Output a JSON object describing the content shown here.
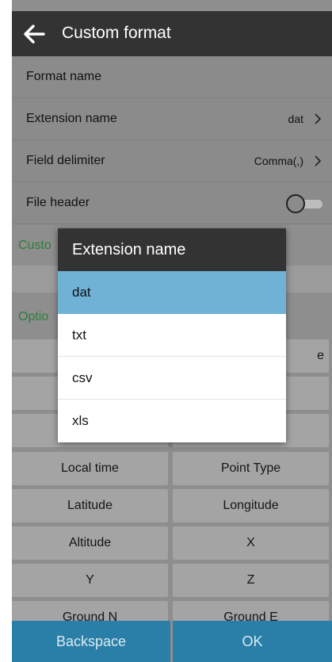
{
  "header": {
    "title": "Custom format"
  },
  "settings": {
    "format_name": {
      "label": "Format name"
    },
    "extension_name": {
      "label": "Extension name",
      "value": "dat"
    },
    "field_delimiter": {
      "label": "Field delimiter",
      "value": "Comma(,)"
    },
    "file_header": {
      "label": "File header",
      "enabled": false
    }
  },
  "sections": {
    "custom_partial": "Custo",
    "optional_partial": "Optio"
  },
  "fields": {
    "partial_right_label": "e",
    "items": [
      "Local time",
      "Point Type",
      "Latitude",
      "Longitude",
      "Altitude",
      "X",
      "Y",
      "Z",
      "Ground N",
      "Ground E"
    ]
  },
  "buttons": {
    "backspace": "Backspace",
    "ok": "OK"
  },
  "dialog": {
    "title": "Extension name",
    "options": [
      "dat",
      "txt",
      "csv",
      "xls"
    ],
    "selected": "dat"
  },
  "colors": {
    "topbar": "#333333",
    "dialog_selected": "#6fb2d6",
    "button_bg": "#2a7fa8",
    "section_text": "#2e7d3a",
    "overlay_dim": "#8e8e8e"
  }
}
